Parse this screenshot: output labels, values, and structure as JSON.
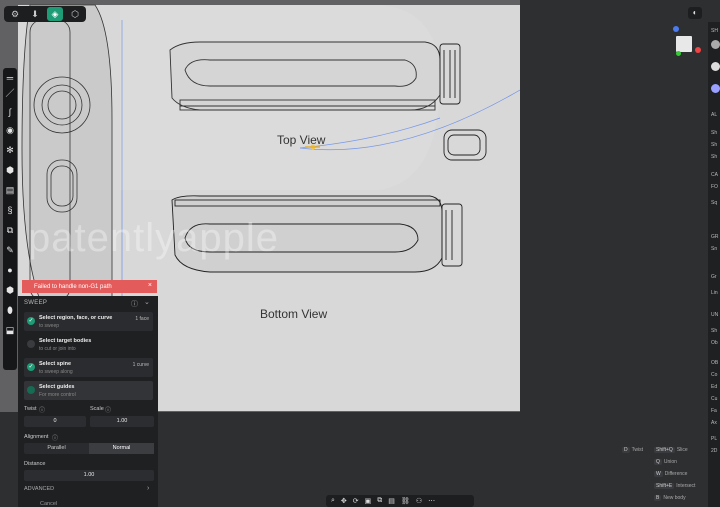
{
  "viewbar": {
    "icons": [
      "settings-icon",
      "download-icon",
      "box-icon",
      "cube-icon"
    ]
  },
  "canvas": {
    "top_view_label": "Top View",
    "bottom_view_label": "Bottom View",
    "watermark": "patentlyapple"
  },
  "toast": {
    "message": "Failed to handle non-G1 path",
    "close": "×"
  },
  "sweep": {
    "title": "SWEEP",
    "steps": [
      {
        "title": "Select region, face, or curve",
        "subtitle": "to sweep",
        "count": "1 face",
        "checked": true
      },
      {
        "title": "Select target bodies",
        "subtitle": "to cut or join into",
        "count": "",
        "checked": false
      },
      {
        "title": "Select spine",
        "subtitle": "to sweep along",
        "count": "1 curve",
        "checked": true
      },
      {
        "title": "Select guides",
        "subtitle": "For more control",
        "count": "",
        "checked": false
      }
    ],
    "twist_label": "Twist",
    "scale_label": "Scale",
    "twist_value": "0",
    "scale_value": "1.00",
    "alignment_label": "Alignment",
    "alignment_options": [
      "Parallel",
      "Normal"
    ],
    "alignment_selected": "Normal",
    "distance_label": "Distance",
    "distance_value": "1.00",
    "advanced_label": "ADVANCED",
    "cancel_label": "Cancel"
  },
  "shortcuts": [
    {
      "key": "D",
      "label": "Twist"
    },
    {
      "key": "Shift+Q",
      "label": "Slice"
    },
    {
      "key": "Q",
      "label": "Union"
    },
    {
      "key": "W",
      "label": "Difference"
    },
    {
      "key": "Shift+E",
      "label": "Intersect"
    },
    {
      "key": "B",
      "label": "New body"
    }
  ],
  "right_panel": {
    "labels": [
      "SH",
      "AL",
      "Sh",
      "Sh",
      "Sh",
      "CA",
      "FO",
      "Sq",
      "GR",
      "Sn",
      "Gr",
      "Lin",
      "UN",
      "Sh",
      "Ob",
      "OB",
      "Co",
      "Ed",
      "Cu",
      "Fa",
      "Ax",
      "PL",
      "2D"
    ]
  },
  "colors": {
    "accent": "#1e9c75",
    "error": "#e35b5b"
  }
}
